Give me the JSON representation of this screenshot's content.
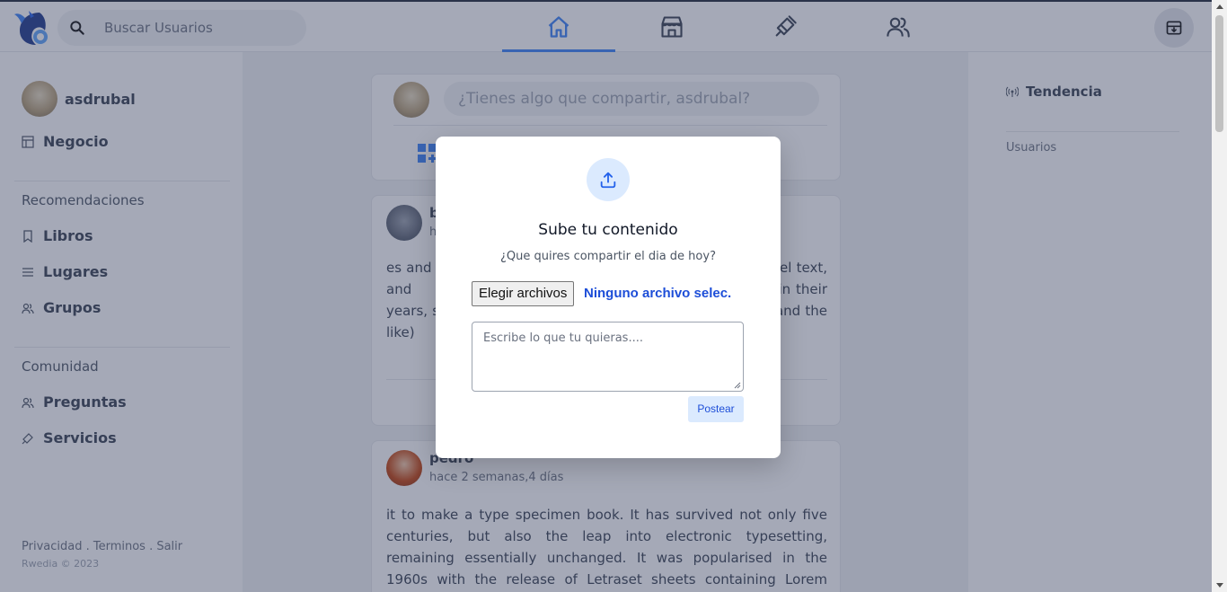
{
  "search": {
    "placeholder": "Buscar Usuarios"
  },
  "nav": [
    {
      "name": "home",
      "active": true
    },
    {
      "name": "store"
    },
    {
      "name": "services"
    },
    {
      "name": "users"
    }
  ],
  "user": {
    "name": "asdrubal"
  },
  "left": {
    "business": "Negocio",
    "recommendations_title": "Recomendaciones",
    "recommendations": [
      "Libros",
      "Lugares",
      "Grupos"
    ],
    "community_title": "Comunidad",
    "community": [
      "Preguntas",
      "Servicios"
    ],
    "footer": "Privacidad . Terminos . Salir",
    "footer2": "Rwedia © 2023"
  },
  "composer": {
    "placeholder": "¿Tienes algo que compartir, asdrubal?"
  },
  "posts": [
    {
      "name": "b",
      "time": "ha",
      "text": "es and w                                                              t model text, and                                                           tes still in their                                                         years, sometim                                                       our and the like)"
    },
    {
      "name": "pedro",
      "time": "hace 2 semanas,4 días",
      "text": "it to make a type specimen book. It has survived not only five centuries, but also the leap into electronic typesetting, remaining essentially unchanged. It was popularised in the 1960s with the release of Letraset sheets containing Lorem Ipsum passages, and"
    }
  ],
  "right": {
    "trend": "Tendencia",
    "users": "Usuarios"
  },
  "modal": {
    "title": "Sube tu contenido",
    "subtitle": "¿Que quires compartir el dia de hoy?",
    "file_button": "Elegir archivos",
    "file_status": "Ninguno archivo selec.",
    "textarea_placeholder": "Escribe lo que tu quieras....",
    "post_button": "Postear"
  },
  "colors": {
    "accent": "#3b82f6",
    "overlay": "#37415f"
  }
}
